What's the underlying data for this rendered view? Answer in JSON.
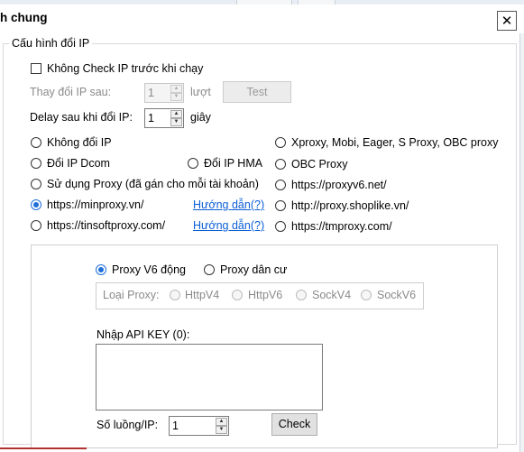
{
  "window": {
    "title": "h chung",
    "close_glyph": "✕"
  },
  "group": {
    "title": "Cấu hình đổi IP"
  },
  "no_check": {
    "label": "Không Check IP trước khi chạy",
    "checked": false
  },
  "change_after": {
    "label": "Thay đổi IP sau:",
    "value": "1",
    "unit": "lượt",
    "test_label": "Test"
  },
  "delay": {
    "label": "Delay sau khi đổi IP:",
    "value": "1",
    "unit": "giây"
  },
  "options": {
    "no_change": "Không đổi IP",
    "dcom": "Đổi IP Dcom",
    "hma": "Đổi IP HMA",
    "use_proxy": "Sử dụng Proxy (đã gán cho mỗi tài khoản)",
    "minproxy": "https://minproxy.vn/",
    "tinsoft": "https://tinsoftproxy.com/",
    "xproxy": "Xproxy, Mobi, Eager, S Proxy, OBC proxy",
    "obc": "OBC Proxy",
    "proxyv6": "https://proxyv6.net/",
    "shoplike": "http://proxy.shoplike.vn/",
    "tmproxy": "https://tmproxy.com/",
    "guide_label": "Hướng dẫn(?)",
    "selected": "minproxy"
  },
  "minproxy_panel": {
    "v6_label": "Proxy V6 động",
    "residential_label": "Proxy dân cư",
    "selected_kind": "v6",
    "proxy_type_label": "Loại Proxy:",
    "types": [
      "HttpV4",
      "HttpV6",
      "SockV4",
      "SockV6"
    ],
    "api_key_label": "Nhập API KEY (0):",
    "api_key_value": "",
    "threads_label": "Số luồng/IP:",
    "threads_value": "1",
    "check_label": "Check"
  },
  "icons": {
    "spin_up": "▲",
    "spin_down": "▼"
  }
}
